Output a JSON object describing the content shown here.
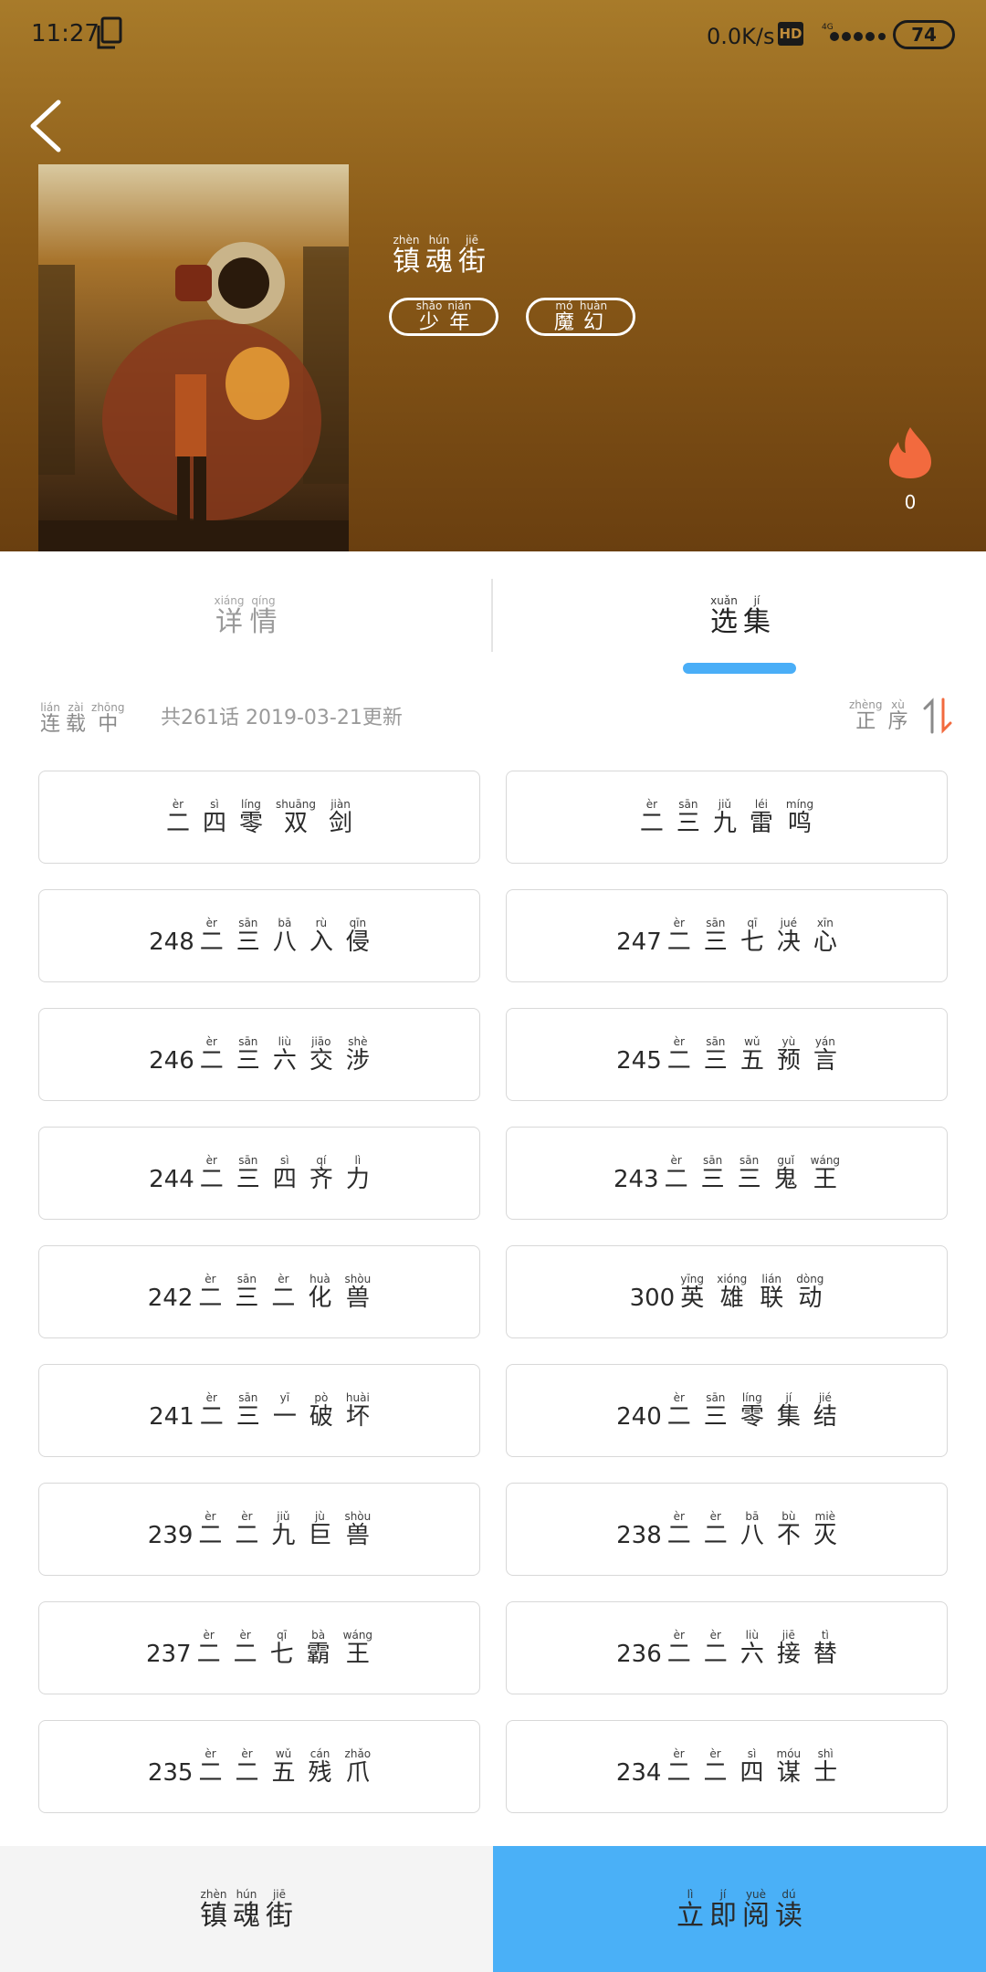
{
  "status_bar": {
    "time": "11:27",
    "net_speed": "0.0K/s",
    "hd": "HD",
    "battery": "74",
    "icons": [
      "copy-icon",
      "hd-icon",
      "signal-icon",
      "battery-icon"
    ]
  },
  "book": {
    "title_pinyin": [
      "zhèn",
      "hún",
      "jiē"
    ],
    "title_chars": [
      "镇",
      "魂",
      "街"
    ],
    "cover_title": "镇魂街",
    "tags": [
      {
        "pinyin": [
          "shǎo",
          "nián"
        ],
        "chars": [
          "少",
          "年"
        ]
      },
      {
        "pinyin": [
          "mó",
          "huàn"
        ],
        "chars": [
          "魔",
          "幻"
        ]
      }
    ],
    "hot_count": "0"
  },
  "tabs": [
    {
      "pinyin": [
        "xiáng",
        "qíng"
      ],
      "chars": [
        "详",
        "情"
      ],
      "active": false
    },
    {
      "pinyin": [
        "xuǎn",
        "jí"
      ],
      "chars": [
        "选",
        "集"
      ],
      "active": true
    }
  ],
  "info": {
    "status_pinyin": [
      "lián",
      "zài",
      "zhōng"
    ],
    "status_chars": [
      "连",
      "载",
      "中"
    ],
    "meta": "共261话 2019-03-21更新",
    "sort_pinyin": [
      "zhèng",
      "xù"
    ],
    "sort_chars": [
      "正",
      "序"
    ]
  },
  "episodes": [
    {
      "num": "",
      "pinyin": [
        "èr",
        "sì",
        "líng",
        "shuāng",
        "jiàn"
      ],
      "chars": [
        "二",
        "四",
        "零",
        "双",
        "剑"
      ]
    },
    {
      "num": "",
      "pinyin": [
        "èr",
        "sān",
        "jiǔ",
        "léi",
        "míng"
      ],
      "chars": [
        "二",
        "三",
        "九",
        "雷",
        "鸣"
      ]
    },
    {
      "num": "248",
      "pinyin": [
        "èr",
        "sān",
        "bā",
        "rù",
        "qīn"
      ],
      "chars": [
        "二",
        "三",
        "八",
        "入",
        "侵"
      ]
    },
    {
      "num": "247",
      "pinyin": [
        "èr",
        "sān",
        "qī",
        "jué",
        "xīn"
      ],
      "chars": [
        "二",
        "三",
        "七",
        "决",
        "心"
      ]
    },
    {
      "num": "246",
      "pinyin": [
        "èr",
        "sān",
        "liù",
        "jiāo",
        "shè"
      ],
      "chars": [
        "二",
        "三",
        "六",
        "交",
        "涉"
      ]
    },
    {
      "num": "245",
      "pinyin": [
        "èr",
        "sān",
        "wǔ",
        "yù",
        "yán"
      ],
      "chars": [
        "二",
        "三",
        "五",
        "预",
        "言"
      ]
    },
    {
      "num": "244",
      "pinyin": [
        "èr",
        "sān",
        "sì",
        "qí",
        "lì"
      ],
      "chars": [
        "二",
        "三",
        "四",
        "齐",
        "力"
      ]
    },
    {
      "num": "243",
      "pinyin": [
        "èr",
        "sān",
        "sān",
        "guǐ",
        "wáng"
      ],
      "chars": [
        "二",
        "三",
        "三",
        "鬼",
        "王"
      ]
    },
    {
      "num": "242",
      "pinyin": [
        "èr",
        "sān",
        "èr",
        "huà",
        "shòu"
      ],
      "chars": [
        "二",
        "三",
        "二",
        "化",
        "兽"
      ]
    },
    {
      "num": "300",
      "pinyin": [
        "yīng",
        "xióng",
        "lián",
        "dòng"
      ],
      "chars": [
        "英",
        "雄",
        "联",
        "动"
      ]
    },
    {
      "num": "241",
      "pinyin": [
        "èr",
        "sān",
        "yī",
        "pò",
        "huài"
      ],
      "chars": [
        "二",
        "三",
        "一",
        "破",
        "坏"
      ]
    },
    {
      "num": "240",
      "pinyin": [
        "èr",
        "sān",
        "líng",
        "jí",
        "jié"
      ],
      "chars": [
        "二",
        "三",
        "零",
        "集",
        "结"
      ]
    },
    {
      "num": "239",
      "pinyin": [
        "èr",
        "èr",
        "jiǔ",
        "jù",
        "shòu"
      ],
      "chars": [
        "二",
        "二",
        "九",
        "巨",
        "兽"
      ]
    },
    {
      "num": "238",
      "pinyin": [
        "èr",
        "èr",
        "bā",
        "bù",
        "miè"
      ],
      "chars": [
        "二",
        "二",
        "八",
        "不",
        "灭"
      ]
    },
    {
      "num": "237",
      "pinyin": [
        "èr",
        "èr",
        "qī",
        "bà",
        "wáng"
      ],
      "chars": [
        "二",
        "二",
        "七",
        "霸",
        "王"
      ]
    },
    {
      "num": "236",
      "pinyin": [
        "èr",
        "èr",
        "liù",
        "jiē",
        "tì"
      ],
      "chars": [
        "二",
        "二",
        "六",
        "接",
        "替"
      ]
    },
    {
      "num": "235",
      "pinyin": [
        "èr",
        "èr",
        "wǔ",
        "cán",
        "zhǎo"
      ],
      "chars": [
        "二",
        "二",
        "五",
        "残",
        "爪"
      ]
    },
    {
      "num": "234",
      "pinyin": [
        "èr",
        "èr",
        "sì",
        "móu",
        "shì"
      ],
      "chars": [
        "二",
        "二",
        "四",
        "谋",
        "士"
      ]
    }
  ],
  "bottom": {
    "title_pinyin": [
      "zhèn",
      "hún",
      "jiē"
    ],
    "title_chars": [
      "镇",
      "魂",
      "街"
    ],
    "read_pinyin": [
      "lì",
      "jí",
      "yuè",
      "dú"
    ],
    "read_chars": [
      "立",
      "即",
      "阅",
      "读"
    ]
  },
  "colors": {
    "accent": "#4ab0f7",
    "header_top": "#a87b2a",
    "header_bottom": "#6a3f10",
    "hot": "#f26a3e"
  }
}
